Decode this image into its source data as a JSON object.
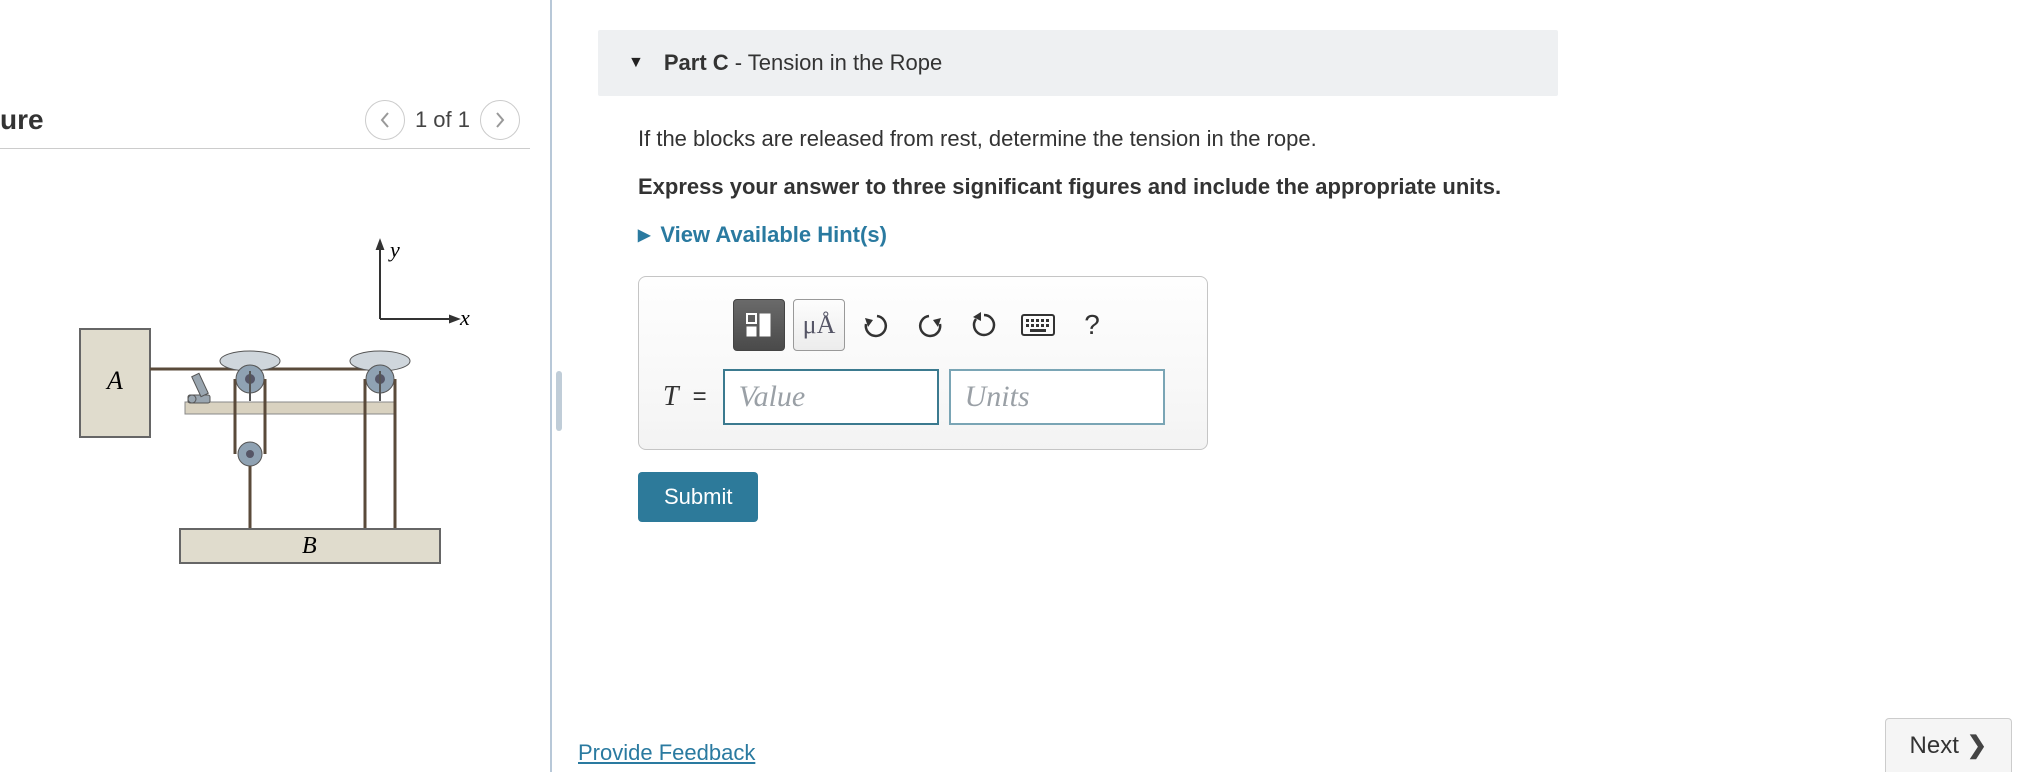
{
  "figure": {
    "title": "ure",
    "nav_count": "1 of 1",
    "labels": {
      "block_a": "A",
      "block_b": "B",
      "axis_x": "x",
      "axis_y": "y"
    }
  },
  "part": {
    "caret": "▼",
    "label_bold": "Part C",
    "label_sep": " - ",
    "label_rest": "Tension in the Rope"
  },
  "prompt": "If the blocks are released from rest, determine the tension in the rope.",
  "instruction": "Express your answer to three significant figures and include the appropriate units.",
  "hints": {
    "caret": "▶",
    "label": "View Available Hint(s)"
  },
  "answer": {
    "variable": "T",
    "equals": "=",
    "value_placeholder": "Value",
    "units_placeholder": "Units",
    "special_chars_label": "μÅ",
    "help_label": "?"
  },
  "submit_label": "Submit",
  "feedback_label": "Provide Feedback",
  "next_label": "Next"
}
